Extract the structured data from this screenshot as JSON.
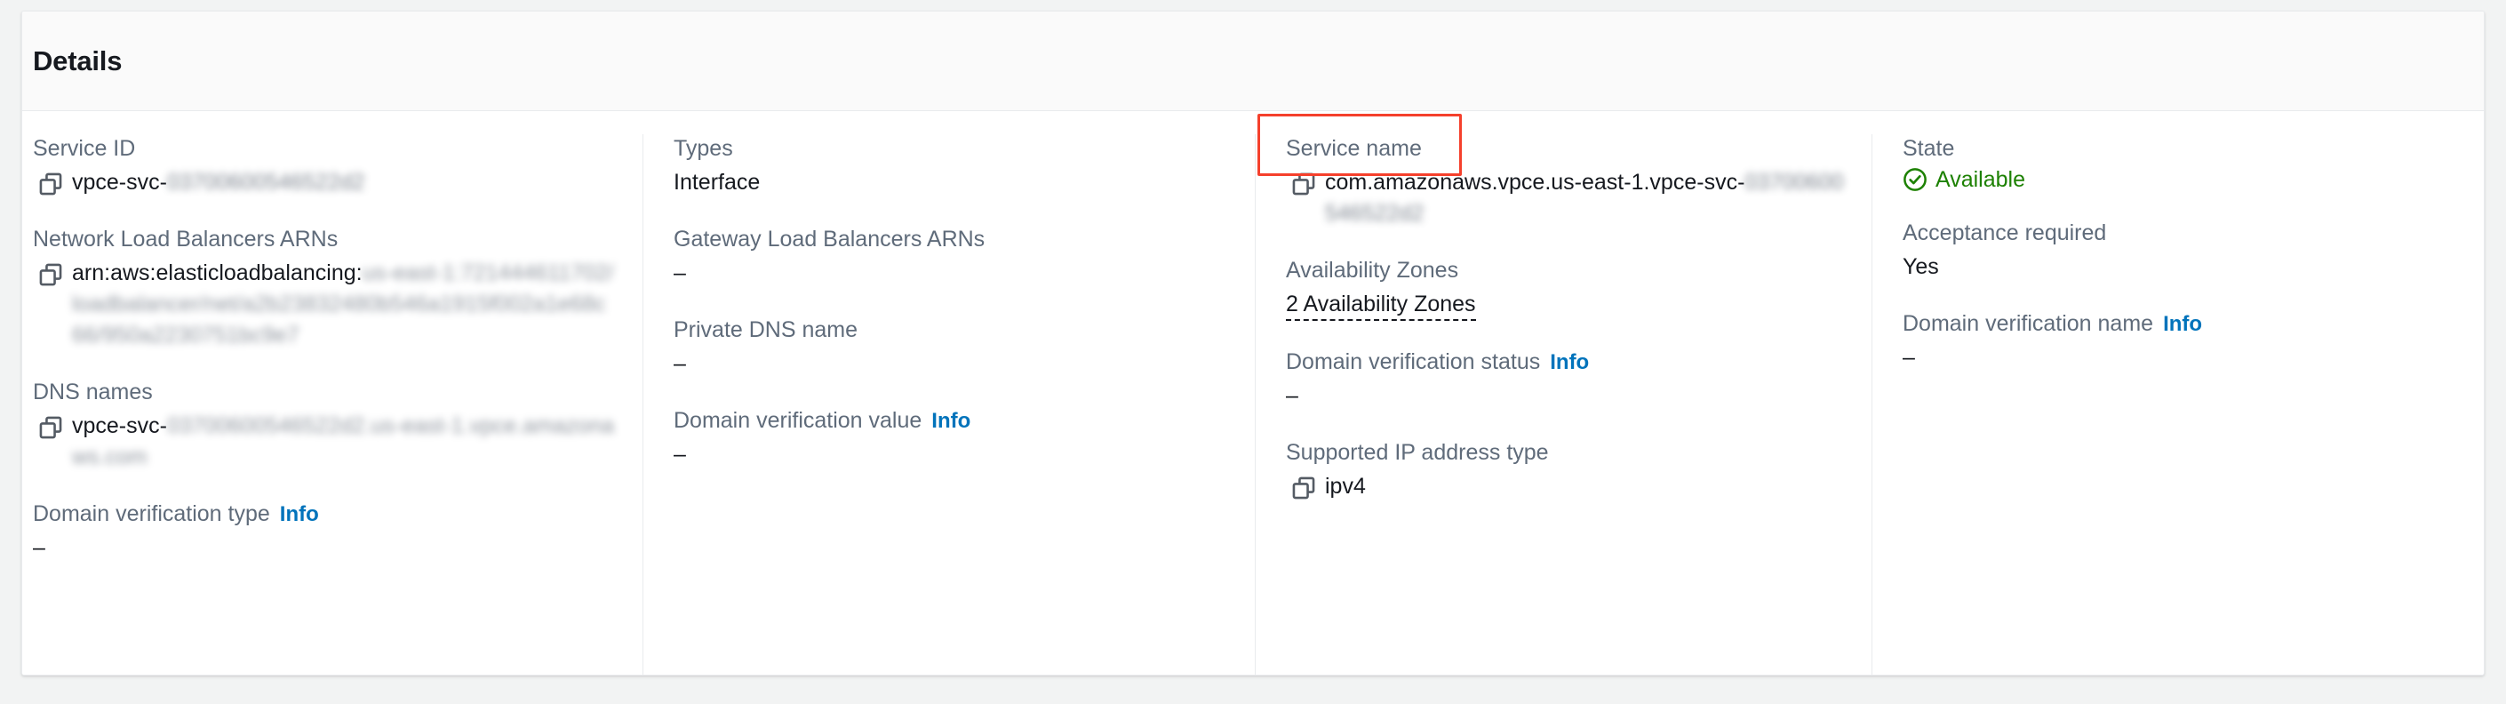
{
  "panel": {
    "title": "Details"
  },
  "icons": {
    "copy": "copy-icon",
    "status_ok": "check-circle-icon"
  },
  "colors": {
    "accent_link": "#0073bb",
    "status_available": "#1d8102",
    "annotation": "#f5402c",
    "label": "#5f6b7a",
    "value": "#16191f"
  },
  "info_label": "Info",
  "columns": [
    {
      "fields": [
        {
          "label": "Service ID",
          "value_prefix": "vpce-svc-",
          "value_redacted": "03700600546522d2",
          "copyable": true
        },
        {
          "label": "Network Load Balancers ARNs",
          "value_prefix": "arn:aws:elasticloadbalancing:",
          "value_redacted": "us-east-1:721444611702/loadbalancer/net/a2b23832480b546a1915f002a1e68c66/950a2230751bc9e7",
          "copyable": true
        },
        {
          "label": "DNS names",
          "value_prefix": "vpce-svc-",
          "value_redacted": "03700600546522d2.us-east-1.vpce.amazonaws.com",
          "copyable": true
        },
        {
          "label": "Domain verification type",
          "info": true,
          "value": "–"
        }
      ]
    },
    {
      "fields": [
        {
          "label": "Types",
          "value": "Interface"
        },
        {
          "label": "Gateway Load Balancers ARNs",
          "value": "–"
        },
        {
          "label": "Private DNS name",
          "value": "–"
        },
        {
          "label": "Domain verification value",
          "info": true,
          "value": "–"
        }
      ]
    },
    {
      "fields": [
        {
          "label": "Service name",
          "highlighted": true,
          "value_prefix": "com.amazonaws.vpce.us-east-1.vpce-svc-",
          "value_redacted": "03700600546522d2",
          "copyable": true
        },
        {
          "label": "Availability Zones",
          "link_value": "2 Availability Zones"
        },
        {
          "label": "Domain verification status",
          "info": true,
          "value": "–"
        },
        {
          "label": "Supported IP address type",
          "value": "ipv4",
          "copyable": true
        }
      ]
    },
    {
      "fields": [
        {
          "label": "State",
          "status_value": "Available",
          "status": "ok"
        },
        {
          "label": "Acceptance required",
          "value": "Yes"
        },
        {
          "label": "Domain verification name",
          "info": true,
          "value": "–"
        }
      ]
    }
  ]
}
